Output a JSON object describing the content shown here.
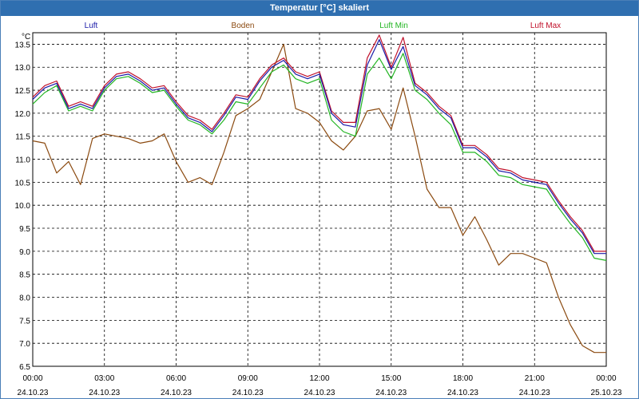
{
  "chart_data": {
    "type": "line",
    "title": "Temperatur [°C] skaliert",
    "ylabel": "°C",
    "ylim": [
      6.5,
      13.75
    ],
    "yticks": [
      "13.5",
      "13.0",
      "12.5",
      "12.0",
      "11.5",
      "11.0",
      "10.5",
      "10.0",
      "9.5",
      "9.0",
      "8.5",
      "8.0",
      "7.5",
      "7.0",
      "6.5"
    ],
    "xticks": [
      {
        "time": "00:00",
        "date": "24.10.23"
      },
      {
        "time": "03:00",
        "date": "24.10.23"
      },
      {
        "time": "06:00",
        "date": "24.10.23"
      },
      {
        "time": "09:00",
        "date": "24.10.23"
      },
      {
        "time": "12:00",
        "date": "24.10.23"
      },
      {
        "time": "15:00",
        "date": "24.10.23"
      },
      {
        "time": "18:00",
        "date": "24.10.23"
      },
      {
        "time": "21:00",
        "date": "24.10.23"
      },
      {
        "time": "00:00",
        "date": "25.10.23"
      }
    ],
    "grid": true,
    "x_unit": "hour of 24.10.23",
    "xlim": [
      0,
      24
    ],
    "series": [
      {
        "name": "Luft",
        "color": "#1a1aa8",
        "x": [
          0,
          0.5,
          1,
          1.5,
          2,
          2.5,
          3,
          3.5,
          4,
          4.5,
          5,
          5.5,
          6,
          6.5,
          7,
          7.5,
          8,
          8.5,
          9,
          9.5,
          10,
          10.5,
          11,
          11.5,
          12,
          12.5,
          13,
          13.5,
          14,
          14.5,
          15,
          15.5,
          16,
          16.5,
          17,
          17.5,
          18,
          18.5,
          19,
          19.5,
          20,
          20.5,
          21,
          21.5,
          22,
          22.5,
          23,
          23.5,
          24
        ],
        "y": [
          12.3,
          12.55,
          12.65,
          12.1,
          12.2,
          12.1,
          12.55,
          12.8,
          12.85,
          12.7,
          12.5,
          12.55,
          12.2,
          11.9,
          11.8,
          11.6,
          11.95,
          12.35,
          12.3,
          12.7,
          13.0,
          13.15,
          12.85,
          12.75,
          12.85,
          12.0,
          11.75,
          11.7,
          13.05,
          13.6,
          12.95,
          13.45,
          12.6,
          12.4,
          12.1,
          11.9,
          11.25,
          11.25,
          11.05,
          10.75,
          10.7,
          10.55,
          10.5,
          10.45,
          10.05,
          9.7,
          9.4,
          8.95,
          8.95
        ]
      },
      {
        "name": "Boden",
        "color": "#8b4a10",
        "x": [
          0,
          0.5,
          1,
          1.5,
          2,
          2.5,
          3,
          3.5,
          4,
          4.5,
          5,
          5.5,
          6,
          6.5,
          7,
          7.5,
          8,
          8.5,
          9,
          9.5,
          10,
          10.5,
          11,
          11.5,
          12,
          12.5,
          13,
          13.5,
          14,
          14.5,
          15,
          15.5,
          16,
          16.5,
          17,
          17.5,
          18,
          18.5,
          19,
          19.5,
          20,
          20.5,
          21,
          21.5,
          22,
          22.5,
          23,
          23.5,
          24
        ],
        "y": [
          11.4,
          11.35,
          10.7,
          10.95,
          10.45,
          11.45,
          11.55,
          11.5,
          11.45,
          11.35,
          11.4,
          11.55,
          10.95,
          10.5,
          10.6,
          10.45,
          11.15,
          11.95,
          12.1,
          12.3,
          12.9,
          13.5,
          12.1,
          12.0,
          11.8,
          11.4,
          11.2,
          11.5,
          12.05,
          12.1,
          11.65,
          12.55,
          11.5,
          10.35,
          9.95,
          9.95,
          9.35,
          9.75,
          9.25,
          8.7,
          8.95,
          8.95,
          8.85,
          8.75,
          8.0,
          7.4,
          6.95,
          6.8,
          6.8
        ]
      },
      {
        "name": "Luft Min",
        "color": "#22b522",
        "x": [
          0,
          0.5,
          1,
          1.5,
          2,
          2.5,
          3,
          3.5,
          4,
          4.5,
          5,
          5.5,
          6,
          6.5,
          7,
          7.5,
          8,
          8.5,
          9,
          9.5,
          10,
          10.5,
          11,
          11.5,
          12,
          12.5,
          13,
          13.5,
          14,
          14.5,
          15,
          15.5,
          16,
          16.5,
          17,
          17.5,
          18,
          18.5,
          19,
          19.5,
          20,
          20.5,
          21,
          21.5,
          22,
          22.5,
          23,
          23.5,
          24
        ],
        "y": [
          12.2,
          12.45,
          12.6,
          12.05,
          12.15,
          12.05,
          12.5,
          12.75,
          12.8,
          12.65,
          12.45,
          12.5,
          12.15,
          11.85,
          11.75,
          11.55,
          11.85,
          12.25,
          12.2,
          12.55,
          12.9,
          13.05,
          12.75,
          12.65,
          12.75,
          11.85,
          11.6,
          11.5,
          12.85,
          13.2,
          12.75,
          13.3,
          12.5,
          12.3,
          12.0,
          11.75,
          11.15,
          11.15,
          10.95,
          10.65,
          10.6,
          10.45,
          10.4,
          10.35,
          9.95,
          9.6,
          9.3,
          8.85,
          8.8
        ]
      },
      {
        "name": "Luft Max",
        "color": "#c0102a",
        "x": [
          0,
          0.5,
          1,
          1.5,
          2,
          2.5,
          3,
          3.5,
          4,
          4.5,
          5,
          5.5,
          6,
          6.5,
          7,
          7.5,
          8,
          8.5,
          9,
          9.5,
          10,
          10.5,
          11,
          11.5,
          12,
          12.5,
          13,
          13.5,
          14,
          14.5,
          15,
          15.5,
          16,
          16.5,
          17,
          17.5,
          18,
          18.5,
          19,
          19.5,
          20,
          20.5,
          21,
          21.5,
          22,
          22.5,
          23,
          23.5,
          24
        ],
        "y": [
          12.35,
          12.6,
          12.7,
          12.15,
          12.25,
          12.15,
          12.6,
          12.85,
          12.9,
          12.75,
          12.55,
          12.6,
          12.25,
          11.95,
          11.85,
          11.65,
          12.0,
          12.4,
          12.35,
          12.75,
          13.05,
          13.2,
          12.9,
          12.8,
          12.9,
          12.05,
          11.8,
          11.8,
          13.2,
          13.7,
          13.0,
          13.65,
          12.65,
          12.45,
          12.15,
          11.95,
          11.3,
          11.3,
          11.1,
          10.8,
          10.75,
          10.6,
          10.55,
          10.5,
          10.1,
          9.75,
          9.45,
          9.0,
          9.0
        ]
      }
    ]
  }
}
